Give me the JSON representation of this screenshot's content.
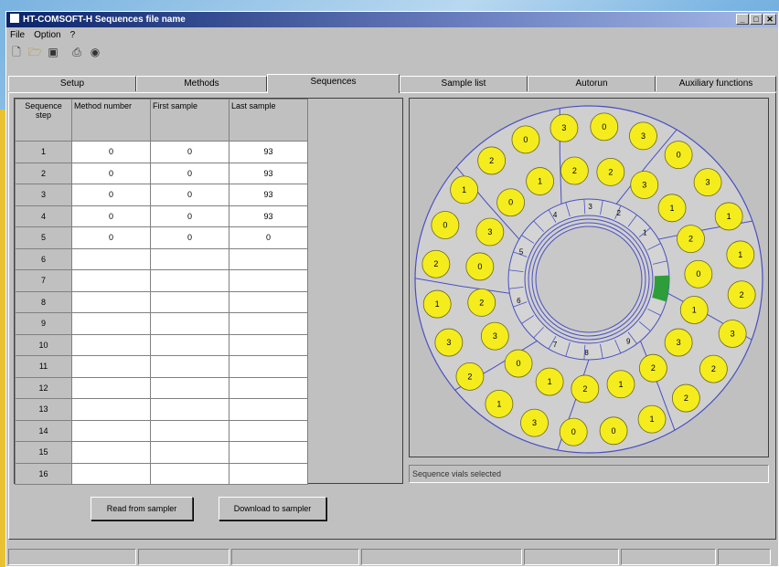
{
  "window": {
    "title": "HT-COMSOFT-H Sequences file name",
    "controls": [
      "_",
      "□",
      "✕"
    ]
  },
  "menu": [
    "File",
    "Option",
    "?"
  ],
  "toolbar": {
    "icons": [
      "new-file-icon",
      "open-folder-icon",
      "save-icon",
      "print-icon",
      "find-icon"
    ]
  },
  "tabs": [
    {
      "label": "Setup"
    },
    {
      "label": "Methods"
    },
    {
      "label": "Sequences",
      "active": true
    },
    {
      "label": "Sample list"
    },
    {
      "label": "Autorun"
    },
    {
      "label": "Auxiliary functions"
    }
  ],
  "grid": {
    "headers": [
      "Sequence step",
      "Method number",
      "First sample",
      "Last sample"
    ],
    "rows": [
      {
        "step": "1",
        "method": "0",
        "first": "0",
        "last": "93"
      },
      {
        "step": "2",
        "method": "0",
        "first": "0",
        "last": "93"
      },
      {
        "step": "3",
        "method": "0",
        "first": "0",
        "last": "93"
      },
      {
        "step": "4",
        "method": "0",
        "first": "0",
        "last": "93"
      },
      {
        "step": "5",
        "method": "0",
        "first": "0",
        "last": "0"
      },
      {
        "step": "6",
        "method": "",
        "first": "",
        "last": ""
      },
      {
        "step": "7",
        "method": "",
        "first": "",
        "last": ""
      },
      {
        "step": "8",
        "method": "",
        "first": "",
        "last": ""
      },
      {
        "step": "9",
        "method": "",
        "first": "",
        "last": ""
      },
      {
        "step": "10",
        "method": "",
        "first": "",
        "last": ""
      },
      {
        "step": "11",
        "method": "",
        "first": "",
        "last": ""
      },
      {
        "step": "12",
        "method": "",
        "first": "",
        "last": ""
      },
      {
        "step": "13",
        "method": "",
        "first": "",
        "last": ""
      },
      {
        "step": "14",
        "method": "",
        "first": "",
        "last": ""
      },
      {
        "step": "15",
        "method": "",
        "first": "",
        "last": ""
      },
      {
        "step": "16",
        "method": "",
        "first": "",
        "last": ""
      }
    ]
  },
  "buttons": {
    "read": "Read from sampler",
    "download": "Download to sampler"
  },
  "carousel": {
    "sector_labels": [
      "1",
      "2",
      "3",
      "4",
      "5",
      "6",
      "7",
      "8",
      "9"
    ],
    "vial_fill": "#f5ec1e",
    "selected_color": "#2e9e3a",
    "outline_color": "#4a4fc0",
    "vials": [
      "0",
      "3",
      "0",
      "3",
      "1",
      "1",
      "2",
      "3",
      "2",
      "2",
      "1",
      "0",
      "0",
      "3",
      "1",
      "2",
      "3",
      "1",
      "2",
      "0",
      "1",
      "2",
      "0",
      "3",
      "2",
      "3",
      "1",
      "2",
      "0",
      "1",
      "3",
      "2",
      "1",
      "2",
      "1",
      "0",
      "3",
      "2",
      "0",
      "3",
      "0",
      "1",
      "2"
    ]
  },
  "status": {
    "message": "Sequence vials selected"
  }
}
